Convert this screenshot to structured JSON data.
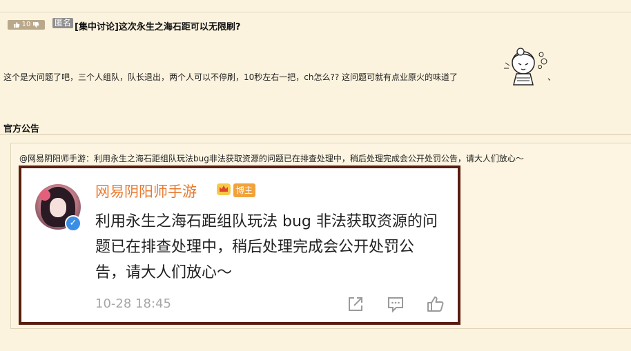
{
  "post": {
    "vote_count": "10",
    "anon_tag": "匿名",
    "title": "[集中讨论]这次永生之海石距可以无限刷?",
    "body": "这个是大问题了吧，三个人组队，队长退出，两个人可以不停刷，10秒左右一把，ch怎么?? 这问题可就有点业原火的味道了",
    "trail": "、"
  },
  "section": {
    "title": "官方公告"
  },
  "quote": {
    "text": "@网易阴阳师手游：利用永生之海石距组队玩法bug非法获取资源的问题已在排查处理中，稍后处理完成会公开处罚公告，请大人们放心～"
  },
  "weibo_card": {
    "account_name": "网易阴阳师手游",
    "badge": "博主",
    "content": "利用永生之海石距组队玩法 bug 非法获取资源的问题已在排查处理中，稍后处理完成会公开处罚公告，请大人们放心～",
    "timestamp": "10-28 18:45",
    "accent_color": "#e8792f",
    "border_color": "#5a1c10"
  },
  "icons": [
    "thumbs-up-icon",
    "thumbs-down-icon",
    "crown-icon",
    "verified-icon",
    "share-icon",
    "comment-icon",
    "like-icon"
  ]
}
